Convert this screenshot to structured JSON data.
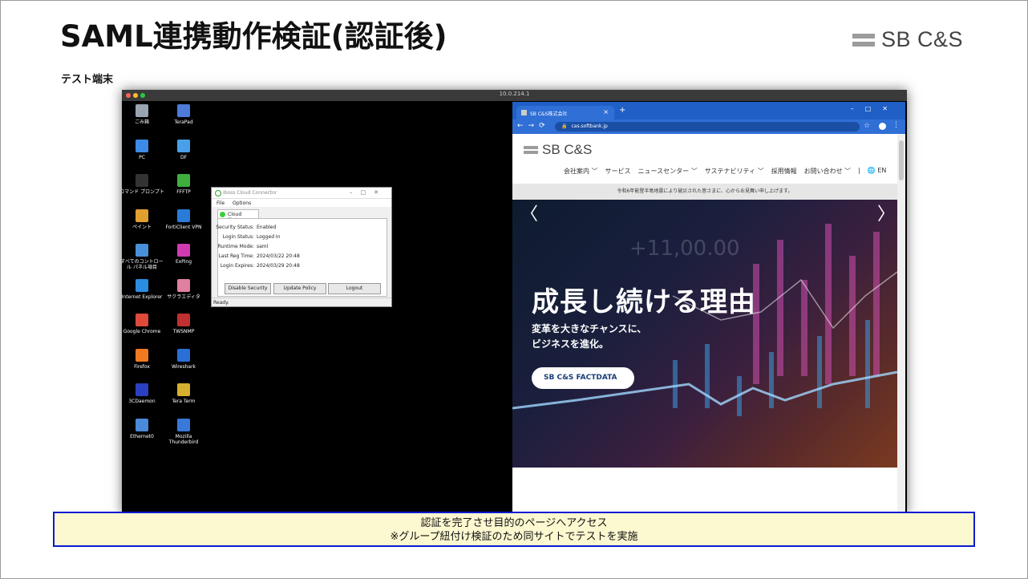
{
  "slide": {
    "title": "SAML連携動作検証(認証後)",
    "logo_text": "SB C&S",
    "subtitle": "テスト端末",
    "caption_line1": "認証を完了させ目的のページへアクセス",
    "caption_line2": "※グループ紐付け検証のため同サイトでテストを実施"
  },
  "remote": {
    "title": "10.0.214.1",
    "desktop_icons": [
      {
        "label": "ごみ箱",
        "icon": "recycle-bin-icon",
        "color": "#9aa4b2"
      },
      {
        "label": "TeraPad",
        "icon": "terapad-icon",
        "color": "#4c7bd9"
      },
      {
        "label": "PC",
        "icon": "pc-icon",
        "color": "#3d8be6"
      },
      {
        "label": "DF",
        "icon": "df-icon",
        "color": "#4aa0e8"
      },
      {
        "label": "コマンド プロンプト",
        "icon": "command-prompt-icon",
        "color": "#333333"
      },
      {
        "label": "FFFTP",
        "icon": "ffftp-icon",
        "color": "#3fae3f"
      },
      {
        "label": "ペイント",
        "icon": "paint-icon",
        "color": "#e0a030"
      },
      {
        "label": "FortiClient VPN",
        "icon": "forticlient-icon",
        "color": "#2a7bd6"
      },
      {
        "label": "すべてのコントロール パネル項目",
        "icon": "control-panel-icon",
        "color": "#4a90d8"
      },
      {
        "label": "ExPing",
        "icon": "exping-icon",
        "color": "#d03ab0"
      },
      {
        "label": "Internet Explorer",
        "icon": "internet-explorer-icon",
        "color": "#2a8de0"
      },
      {
        "label": "サクラエディタ",
        "icon": "sakura-editor-icon",
        "color": "#e080a0"
      },
      {
        "label": "Google Chrome",
        "icon": "google-chrome-icon",
        "color": "#e04a3a"
      },
      {
        "label": "TWSNMP",
        "icon": "twsnmp-icon",
        "color": "#c03030"
      },
      {
        "label": "Firefox",
        "icon": "firefox-icon",
        "color": "#f07a20"
      },
      {
        "label": "Wireshark",
        "icon": "wireshark-icon",
        "color": "#2a6fd6"
      },
      {
        "label": "3CDaemon",
        "icon": "3cdaemon-icon",
        "color": "#2a40c0"
      },
      {
        "label": "Tera Term",
        "icon": "tera-term-icon",
        "color": "#d8b030"
      },
      {
        "label": "Ethernet0",
        "icon": "ethernet-icon",
        "color": "#4a8ad8"
      },
      {
        "label": "Mozilla Thunderbird",
        "icon": "thunderbird-icon",
        "color": "#3a78d8"
      }
    ]
  },
  "connector": {
    "title": "iboss Cloud Connector",
    "menu": [
      "File",
      "Options"
    ],
    "tab": "Cloud Status",
    "rows": [
      {
        "k": "Security Status:",
        "v": "Enabled"
      },
      {
        "k": "Login Status:",
        "v": "Logged In"
      },
      {
        "k": "Runtime Mode:",
        "v": "saml"
      },
      {
        "k": "Last Reg Time:",
        "v": "2024/03/22 20:48"
      },
      {
        "k": "Login Expires:",
        "v": "2024/03/29 20:48"
      }
    ],
    "buttons": [
      "Disable Security",
      "Update Policy",
      "Logout"
    ],
    "status": "Ready."
  },
  "browser": {
    "tab_title": "SB C&S株式会社",
    "url": "cas.softbank.jp",
    "page": {
      "logo": "SB C&S",
      "nav": [
        "会社案内 ﹀",
        "サービス",
        "ニュースセンター ﹀",
        "サステナビリティ ﹀",
        "採用情報",
        "お問い合わせ ﹀",
        "|",
        "🌐 EN"
      ],
      "notice": "令和6年能登半島地震により被災された皆さまに、心からお見舞い申し上げます。",
      "hero_title": "成長し続ける理由",
      "hero_line1": "変革を大きなチャンスに、",
      "hero_line2": "ビジネスを進化。",
      "cta": "SB C&S FACTDATA",
      "ghost_number": "+11,00.00"
    }
  }
}
